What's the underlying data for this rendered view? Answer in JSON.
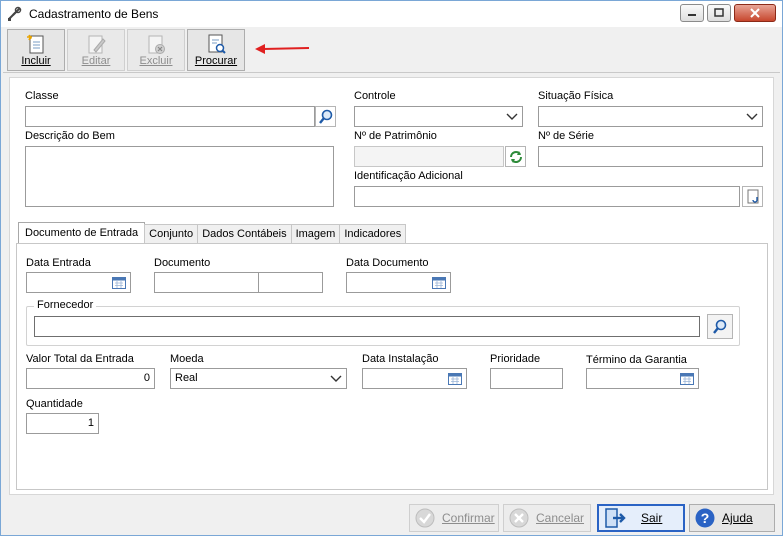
{
  "window": {
    "title": "Cadastramento de Bens"
  },
  "toolbar": {
    "incluir": "Incluir",
    "editar": "Editar",
    "excluir": "Excluir",
    "procurar": "Procurar"
  },
  "form": {
    "classe_label": "Classe",
    "descricao_label": "Descrição do Bem",
    "controle_label": "Controle",
    "situacao_label": "Situação Física",
    "patrimonio_label": "Nº de Patrimônio",
    "serie_label": "Nº de Série",
    "identificacao_label": "Identificação Adicional"
  },
  "tabs": [
    "Documento de Entrada",
    "Conjunto",
    "Dados Contábeis",
    "Imagem",
    "Indicadores"
  ],
  "doc": {
    "data_entrada_label": "Data Entrada",
    "documento_label": "Documento",
    "data_documento_label": "Data Documento",
    "fornecedor_label": "Fornecedor",
    "valor_total_label": "Valor Total da Entrada",
    "valor_total_value": "0",
    "moeda_label": "Moeda",
    "moeda_value": "Real",
    "data_instalacao_label": "Data Instalação",
    "prioridade_label": "Prioridade",
    "termino_label": "Término da Garantia",
    "quantidade_label": "Quantidade",
    "quantidade_value": "1"
  },
  "bottom": {
    "confirmar": "Confirmar",
    "cancelar": "Cancelar",
    "sair": "Sair",
    "ajuda": "Ajuda"
  },
  "colors": {
    "accent_red": "#e02020",
    "focus_blue": "#2b63c4"
  }
}
